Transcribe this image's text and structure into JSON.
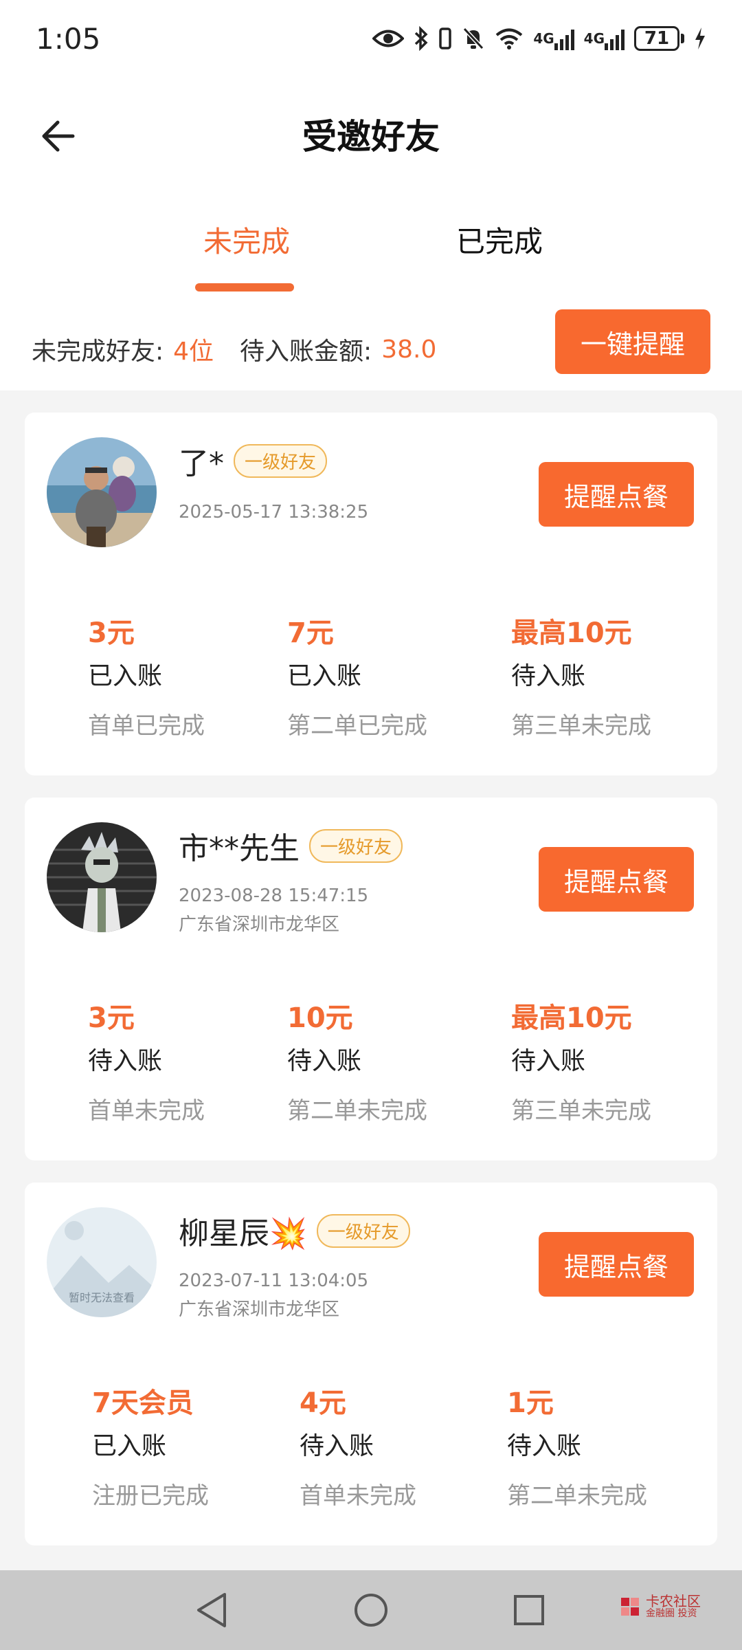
{
  "status_bar": {
    "time": "1:05",
    "network": "4G",
    "battery": "71",
    "icons": [
      "eye-icon",
      "bluetooth-icon",
      "vibrate-icon",
      "mute-icon",
      "wifi-icon",
      "signal-icon",
      "signal-icon",
      "battery-icon",
      "charging-icon"
    ]
  },
  "header": {
    "title": "受邀好友",
    "back_icon": "back-arrow-icon"
  },
  "tabs": [
    {
      "label": "未完成",
      "active": true
    },
    {
      "label": "已完成",
      "active": false
    }
  ],
  "summary": {
    "friends_label": "未完成好友:",
    "friends_value": "4位",
    "pending_label": "待入账金额:",
    "pending_value": "38.0",
    "remind_all_button": "一键提醒"
  },
  "friends": [
    {
      "name": "了*",
      "level": "一级好友",
      "time": "2025-05-17 13:38:25",
      "location": "",
      "button": "提醒点餐",
      "stages": [
        {
          "amount": "3元",
          "state": "已入账",
          "desc": "首单已完成"
        },
        {
          "amount": "7元",
          "state": "已入账",
          "desc": "第二单已完成"
        },
        {
          "amount": "最高10元",
          "state": "待入账",
          "desc": "第三单未完成"
        }
      ]
    },
    {
      "name": "市**先生",
      "level": "一级好友",
      "time": "2023-08-28 15:47:15",
      "location": "广东省深圳市龙华区",
      "button": "提醒点餐",
      "stages": [
        {
          "amount": "3元",
          "state": "待入账",
          "desc": "首单未完成"
        },
        {
          "amount": "10元",
          "state": "待入账",
          "desc": "第二单未完成"
        },
        {
          "amount": "最高10元",
          "state": "待入账",
          "desc": "第三单未完成"
        }
      ]
    },
    {
      "name": "柳星辰💥",
      "level": "一级好友",
      "time": "2023-07-11 13:04:05",
      "location": "广东省深圳市龙华区",
      "button": "提醒点餐",
      "avatar_placeholder": "暂时无法查看",
      "stages": [
        {
          "amount": "7天会员",
          "state": "已入账",
          "desc": "注册已完成"
        },
        {
          "amount": "4元",
          "state": "待入账",
          "desc": "首单未完成"
        },
        {
          "amount": "1元",
          "state": "待入账",
          "desc": "第二单未完成"
        }
      ]
    }
  ],
  "navbar": {
    "back": "nav-back-icon",
    "home": "nav-home-icon",
    "recents": "nav-recents-icon",
    "watermark_line1": "卡农社区",
    "watermark_line2": "金融圈 投资"
  },
  "colors": {
    "accent": "#f26b34",
    "button": "#f8692f",
    "badge_text": "#e59a2a",
    "list_bg": "#f4f4f4"
  }
}
